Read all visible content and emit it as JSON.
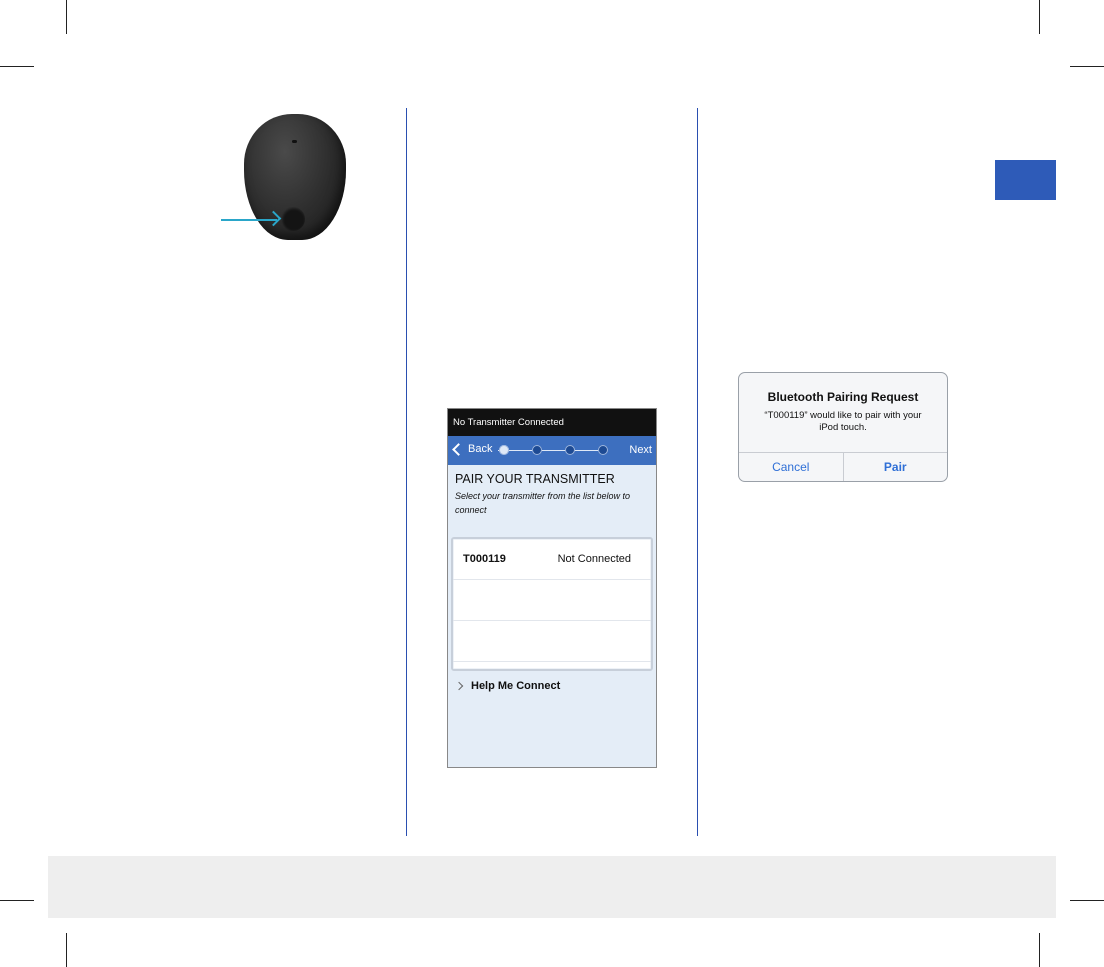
{
  "transmitter_device": {
    "icon": "transmitter-device",
    "arrow_color": "#2aa6c9"
  },
  "phone_screen": {
    "status_bar": "No Transmitter Connected",
    "nav": {
      "back_label": "Back",
      "next_label": "Next",
      "progress_step": 1,
      "progress_total": 4
    },
    "title": "PAIR YOUR TRANSMITTER",
    "subtitle": "Select your transmitter from the list below to connect",
    "transmitters": [
      {
        "id": "T000119",
        "status": "Not Connected"
      }
    ],
    "help_link": "Help Me Connect"
  },
  "bluetooth_dialog": {
    "title": "Bluetooth Pairing Request",
    "message": "“T000119” would like to pair with your iPod touch.",
    "cancel_label": "Cancel",
    "pair_label": "Pair"
  },
  "colors": {
    "accent": "#2e5bb8",
    "divider": "#2a4fb0",
    "nav_blue": "#3d6fbf",
    "footer_band": "#eeeeee"
  }
}
